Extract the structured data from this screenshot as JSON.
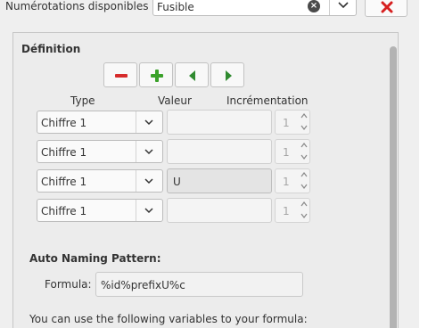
{
  "header": {
    "label": "Numérotations disponibles :",
    "selected": "Fusible"
  },
  "definition": {
    "title": "Définition",
    "columns": {
      "type": "Type",
      "value": "Valeur",
      "increment": "Incrémentation"
    },
    "rows": [
      {
        "type": "Chiffre 1",
        "value": "",
        "increment": "1"
      },
      {
        "type": "Chiffre 1",
        "value": "",
        "increment": "1"
      },
      {
        "type": "Chiffre 1",
        "value": "U",
        "increment": "1"
      },
      {
        "type": "Chiffre 1",
        "value": "",
        "increment": "1"
      }
    ]
  },
  "auto_naming": {
    "title": "Auto Naming Pattern:",
    "formula_label": "Formula:",
    "formula_value": "%id%prefixU%c",
    "help_text": "You can use the following variables to your formula:"
  },
  "icons": {
    "remove": "minus-icon",
    "add": "plus-icon",
    "left": "arrow-left-icon",
    "right": "arrow-right-icon",
    "delete": "red-x-icon",
    "clear": "clear-icon"
  },
  "colors": {
    "remove": "#d62b2b",
    "add": "#3aa12a",
    "arrows": "#2f8a2f",
    "delete": "#d61f1f"
  }
}
